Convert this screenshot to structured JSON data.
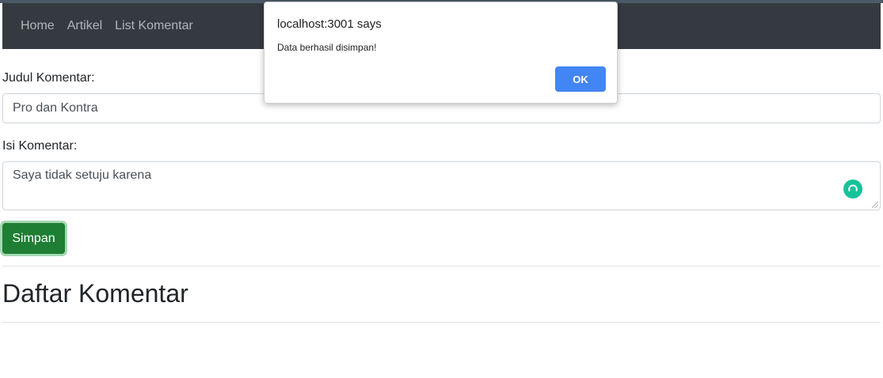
{
  "navbar": {
    "links": [
      "Home",
      "Artikel",
      "List Komentar"
    ]
  },
  "form": {
    "title_label": "Judul Komentar:",
    "title_value": "Pro dan Kontra",
    "content_label": "Isi Komentar:",
    "content_value": "Saya tidak setuju karena",
    "submit_label": "Simpan"
  },
  "list": {
    "heading": "Daftar Komentar"
  },
  "dialog": {
    "title": "localhost:3001 says",
    "message": "Data berhasil disimpan!",
    "ok_label": "OK"
  },
  "colors": {
    "navbar": "#343a40",
    "submit": "#1e7e34",
    "dialog_ok": "#4285f4",
    "grammar_badge": "#15c39a"
  },
  "icons": {
    "grammar_badge": "grammar-assistant-icon",
    "resize": "resize-grip-icon"
  }
}
